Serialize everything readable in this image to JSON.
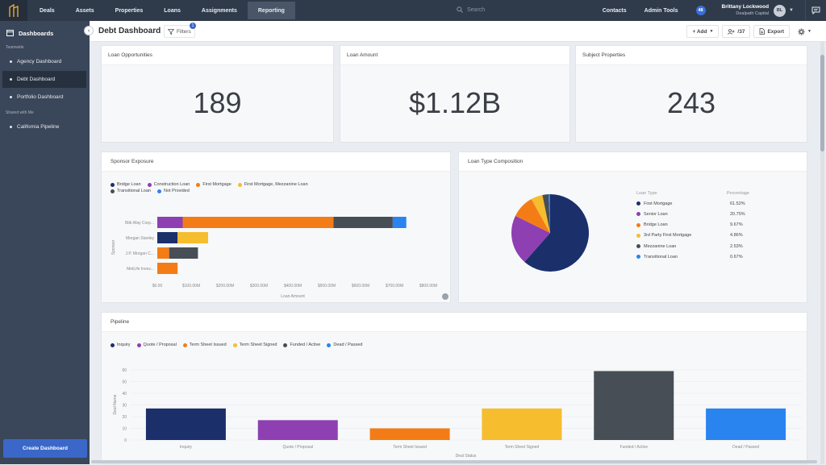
{
  "topbar": {
    "nav": [
      "Deals",
      "Assets",
      "Properties",
      "Loans",
      "Assignments",
      "Reporting"
    ],
    "active_nav": "Reporting",
    "search_placeholder": "Search",
    "links": [
      "Contacts",
      "Admin Tools"
    ],
    "notification_count": "48",
    "user_name": "Brittany Lockwood",
    "user_company": "Dealpath Capital",
    "avatar_initials": "BL"
  },
  "sidebar": {
    "title": "Dashboards",
    "section1": "Teamwide",
    "items1": [
      "Agency Dashboard",
      "Debt Dashboard",
      "Portfolio Dashboard"
    ],
    "active_item": "Debt Dashboard",
    "section2": "Shared with Me",
    "items2": [
      "California Pipeline"
    ],
    "create_button": "Create Dashboard"
  },
  "header": {
    "title": "Debt Dashboard",
    "filters_label": "Filters",
    "filters_badge": "1",
    "add_label": "+ Add",
    "users_label": "/37",
    "export_label": "Export"
  },
  "kpis": [
    {
      "title": "Loan Opportunities",
      "value": "189"
    },
    {
      "title": "Loan Amount",
      "value": "$1.12B"
    },
    {
      "title": "Subject Properties",
      "value": "243"
    }
  ],
  "colors": {
    "navy": "#1b2f6b",
    "purple": "#8e3fb1",
    "orange": "#f47c16",
    "yellow": "#f6bd2e",
    "darkgray": "#474e55",
    "blue": "#2a84f0"
  },
  "sponsor_chart": {
    "title": "Sponsor Exposure",
    "legend": [
      {
        "name": "Bridge Loan",
        "color": "#1b2f6b"
      },
      {
        "name": "Construction Loan",
        "color": "#8e3fb1"
      },
      {
        "name": "First Mortgage",
        "color": "#f47c16"
      },
      {
        "name": "First Mortgage, Mezzanine Loan",
        "color": "#f6bd2e"
      },
      {
        "name": "Transitional Loan",
        "color": "#474e55"
      },
      {
        "name": "Not Provided",
        "color": "#2a84f0"
      }
    ],
    "ylabel": "Sponsor",
    "xlabel": "Loan Amount",
    "xticks": [
      "$0.00",
      "$100.00M",
      "$200.00M",
      "$300.00M",
      "$400.00M",
      "$500.00M",
      "$600.00M",
      "$700.00M",
      "$800.00M"
    ]
  },
  "pie_chart": {
    "title": "Loan Type Composition",
    "col1": "Loan Type",
    "col2": "Percentage"
  },
  "pipeline_chart": {
    "title": "Pipeline",
    "xlabel": "Deal Status",
    "ylabel": "Deal Name",
    "legend": [
      {
        "name": "Inquiry",
        "color": "#1b2f6b"
      },
      {
        "name": "Quote / Proposal",
        "color": "#8e3fb1"
      },
      {
        "name": "Term Sheet Issued",
        "color": "#f47c16"
      },
      {
        "name": "Term Sheet Signed",
        "color": "#f6bd2e"
      },
      {
        "name": "Funded / Active",
        "color": "#474e55"
      },
      {
        "name": "Dead / Passed",
        "color": "#2a84f0"
      }
    ],
    "yticks": [
      "0",
      "10",
      "20",
      "30",
      "40",
      "50",
      "60"
    ]
  },
  "chart_data": [
    {
      "type": "bar",
      "orientation": "horizontal",
      "stacked": true,
      "title": "Sponsor Exposure",
      "xlabel": "Loan Amount",
      "ylabel": "Sponsor",
      "categories": [
        "Bilk-Way Corp...",
        "Morgan Stanley",
        "J.P. Morgan C...",
        "MetLife Inves..."
      ],
      "xlim": [
        0,
        800000000
      ],
      "series": [
        {
          "name": "Bridge Loan",
          "values": [
            0,
            60000000,
            0,
            0
          ]
        },
        {
          "name": "Construction Loan",
          "values": [
            75000000,
            0,
            0,
            0
          ]
        },
        {
          "name": "First Mortgage",
          "values": [
            445000000,
            0,
            35000000,
            60000000
          ]
        },
        {
          "name": "First Mortgage, Mezzanine Loan",
          "values": [
            0,
            90000000,
            0,
            0
          ]
        },
        {
          "name": "Transitional Loan",
          "values": [
            175000000,
            0,
            85000000,
            0
          ]
        },
        {
          "name": "Not Provided",
          "values": [
            40000000,
            0,
            0,
            0
          ]
        }
      ]
    },
    {
      "type": "pie",
      "title": "Loan Type Composition",
      "slices": [
        {
          "label": "First Mortgage",
          "value": 61.52,
          "display": "61.52%",
          "color": "#1b2f6b"
        },
        {
          "label": "Senior Loan",
          "value": 20.75,
          "display": "20.75%",
          "color": "#8e3fb1"
        },
        {
          "label": "Bridge Loan",
          "value": 9.67,
          "display": "9.67%",
          "color": "#f47c16"
        },
        {
          "label": "3rd Party First Mortgage",
          "value": 4.86,
          "display": "4.86%",
          "color": "#f6bd2e"
        },
        {
          "label": "Mezzanine Loan",
          "value": 2.53,
          "display": "2.53%",
          "color": "#474e55"
        },
        {
          "label": "Transitional Loan",
          "value": 0.67,
          "display": "0.67%",
          "color": "#2a84f0"
        }
      ]
    },
    {
      "type": "bar",
      "title": "Pipeline",
      "xlabel": "Deal Status",
      "ylabel": "Deal Name",
      "categories": [
        "Inquiry",
        "Quote / Proposal",
        "Term Sheet Issued",
        "Term Sheet Signed",
        "Funded / Active",
        "Dead / Passed"
      ],
      "values": [
        27,
        17,
        10,
        27,
        59,
        27
      ],
      "colors": [
        "#1b2f6b",
        "#8e3fb1",
        "#f47c16",
        "#f6bd2e",
        "#474e55",
        "#2a84f0"
      ],
      "ylim": [
        0,
        60
      ]
    }
  ]
}
